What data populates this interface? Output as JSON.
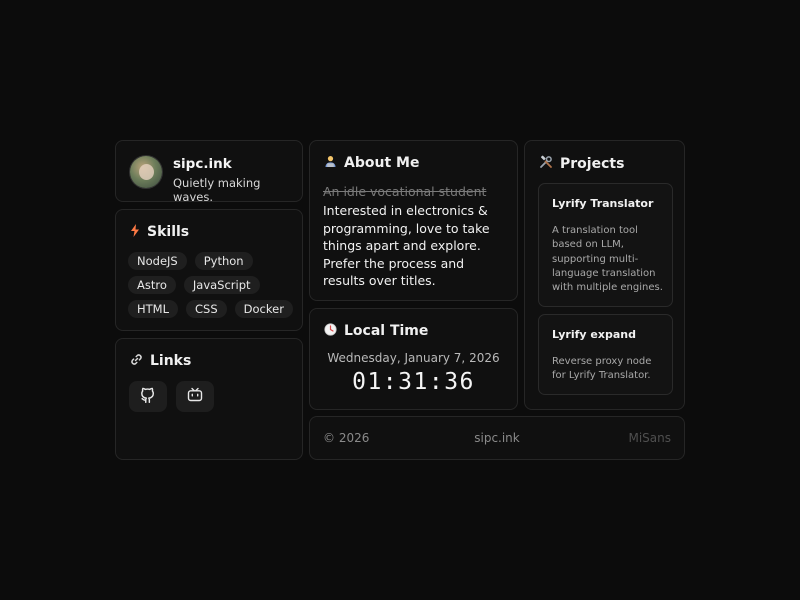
{
  "profile": {
    "name": "sipc.ink",
    "tagline": "Quietly making waves."
  },
  "skills": {
    "title": "Skills",
    "rows": [
      [
        "NodeJS",
        "Python"
      ],
      [
        "Astro",
        "JavaScript"
      ],
      [
        "HTML",
        "CSS",
        "Docker"
      ]
    ]
  },
  "links": {
    "title": "Links",
    "items": [
      {
        "icon": "github-icon"
      },
      {
        "icon": "bilibili-icon"
      }
    ]
  },
  "about": {
    "title": "About Me",
    "struck_text": "An idle vocational student",
    "text": "Interested in electronics & programming, love to take things apart and explore. Prefer the process and results over titles."
  },
  "time": {
    "title": "Local Time",
    "date": "Wednesday, January 7, 2026",
    "clock": "01:31:36"
  },
  "projects": {
    "title": "Projects",
    "items": [
      {
        "name": "Lyrify Translator",
        "description": "A translation tool based on LLM, supporting multi-language translation with multiple engines."
      },
      {
        "name": "Lyrify expand",
        "description": "Reverse proxy node for Lyrify Translator."
      }
    ]
  },
  "footer": {
    "copyright": "© 2026",
    "site": "sipc.ink",
    "font_credit": "MiSans"
  },
  "colors": {
    "background": "#0c0c0c",
    "card_border": "#262626",
    "chip_bg": "#1f1f1f",
    "skills_accent": "#ff7a45"
  }
}
